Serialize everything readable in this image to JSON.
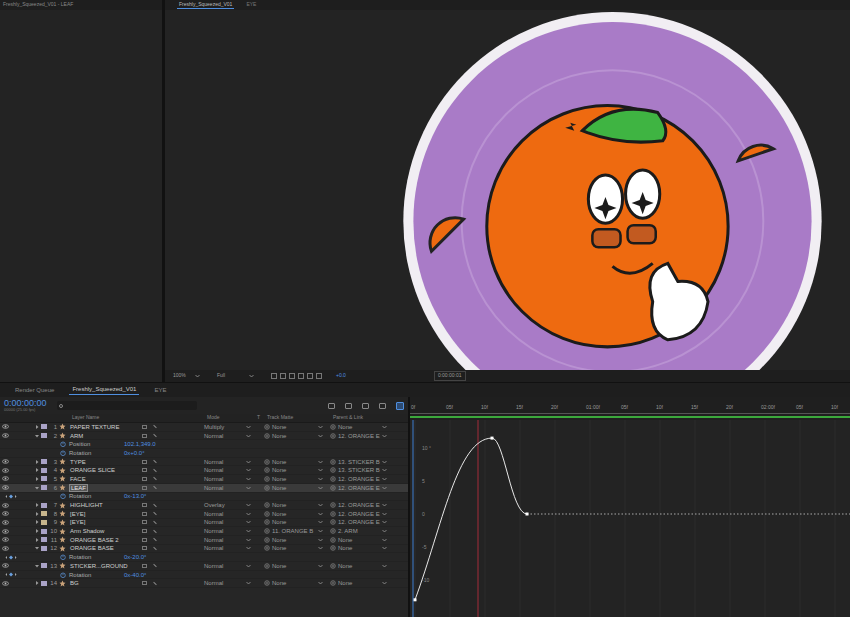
{
  "window": {
    "title": "Freshly_Squeezed_V01 - LEAF"
  },
  "viewer": {
    "tabs": [
      {
        "label": "Freshly_Squeezed_V01",
        "selected": true
      },
      {
        "label": "EYE",
        "selected": false
      }
    ],
    "footer": {
      "zoom": "100%",
      "resolution": "Full",
      "exposure": "+0.0",
      "time": "0:00:00:01"
    }
  },
  "timeline": {
    "tabs": [
      {
        "label": "Render Queue",
        "selected": false
      },
      {
        "label": "Freshly_Squeezed_V01",
        "selected": true
      },
      {
        "label": "EYE",
        "selected": false
      }
    ],
    "timecode": "0:00:00:00",
    "frame_info": "00000 (25.00 fps)",
    "search": {
      "placeholder": ""
    },
    "columns": {
      "name": "Layer Name",
      "mode": "Mode",
      "t": "T",
      "matte": "Track Matte",
      "parent": "Parent & Link"
    },
    "rows": [
      {
        "kind": "layer",
        "num": "1",
        "name": "PAPER TEXTURE",
        "color": "#a9a2c6",
        "mode": "Multiply",
        "matte": "None",
        "parent": "None",
        "selected": false,
        "expanded": false
      },
      {
        "kind": "layer",
        "num": "2",
        "name": "ARM",
        "color": "#a9a2c6",
        "mode": "Normal",
        "matte": "None",
        "parent": "12. ORANGE E",
        "selected": false,
        "expanded": true
      },
      {
        "kind": "property",
        "name": "Position",
        "value": "102.1,349.0",
        "keyframed": false
      },
      {
        "kind": "property",
        "name": "Rotation",
        "value": "0x+0.0°",
        "keyframed": false
      },
      {
        "kind": "layer",
        "num": "3",
        "name": "TYPE",
        "color": "#a9a2c6",
        "mode": "Normal",
        "matte": "None",
        "parent": "13. STICKER B",
        "selected": false,
        "expanded": false
      },
      {
        "kind": "layer",
        "num": "4",
        "name": "ORANGE SLICE",
        "color": "#a9a2c6",
        "mode": "Normal",
        "matte": "None",
        "parent": "13. STICKER B",
        "selected": false,
        "expanded": false
      },
      {
        "kind": "layer",
        "num": "5",
        "name": "FACE",
        "color": "#a9a2c6",
        "mode": "Normal",
        "matte": "None",
        "parent": "12. ORANGE E",
        "selected": false,
        "expanded": false
      },
      {
        "kind": "layer",
        "num": "6",
        "name": "LEAF",
        "color": "#a9a2c6",
        "mode": "Normal",
        "matte": "None",
        "parent": "12. ORANGE E",
        "selected": true,
        "expanded": true
      },
      {
        "kind": "property",
        "name": "Rotation",
        "value": "0x-13.0°",
        "keyframed": true
      },
      {
        "kind": "layer",
        "num": "7",
        "name": "HIGHLIGHT",
        "color": "#a9a2c6",
        "mode": "Overlay",
        "matte": "None",
        "parent": "12. ORANGE E",
        "selected": false,
        "expanded": false
      },
      {
        "kind": "layer",
        "num": "8",
        "name": "[EYE]",
        "color": "#c7b58c",
        "mode": "Normal",
        "matte": "None",
        "parent": "12. ORANGE E",
        "selected": false,
        "expanded": false
      },
      {
        "kind": "layer",
        "num": "9",
        "name": "[EYE]",
        "color": "#c7b58c",
        "mode": "Normal",
        "matte": "None",
        "parent": "12. ORANGE E",
        "selected": false,
        "expanded": false
      },
      {
        "kind": "layer",
        "num": "10",
        "name": "Arm Shadow",
        "color": "#a9a2c6",
        "mode": "Normal",
        "matte": "11. ORANGE B",
        "parent": "2. ARM",
        "selected": false,
        "expanded": false
      },
      {
        "kind": "layer",
        "num": "11",
        "name": "ORANGE BASE 2",
        "color": "#a9a2c6",
        "mode": "Normal",
        "matte": "None",
        "parent": "None",
        "selected": false,
        "expanded": false
      },
      {
        "kind": "layer",
        "num": "12",
        "name": "ORANGE BASE",
        "color": "#a9a2c6",
        "mode": "Normal",
        "matte": "None",
        "parent": "None",
        "selected": false,
        "expanded": true
      },
      {
        "kind": "property",
        "name": "Rotation",
        "value": "0x-20.0°",
        "keyframed": true
      },
      {
        "kind": "layer",
        "num": "13",
        "name": "STICKER...GROUND",
        "color": "#a9a2c6",
        "mode": "Normal",
        "matte": "None",
        "parent": "None",
        "selected": false,
        "expanded": true
      },
      {
        "kind": "property",
        "name": "Rotation",
        "value": "0x-40.0°",
        "keyframed": true
      },
      {
        "kind": "layer",
        "num": "14",
        "name": "BG",
        "color": "#a9a2c6",
        "mode": "Normal",
        "matte": "None",
        "parent": "None",
        "selected": false,
        "expanded": false
      }
    ],
    "ruler": [
      "0f",
      "05f",
      "10f",
      "15f",
      "20f",
      "01:00f",
      "05f",
      "10f",
      "15f",
      "20f",
      "02:00f",
      "05f",
      "10f"
    ],
    "graph": {
      "ticks": [
        {
          "label": "10 °",
          "value": 10
        },
        {
          "label": "5",
          "value": 5
        },
        {
          "label": "0",
          "value": 0
        },
        {
          "label": "-5",
          "value": -5
        },
        {
          "label": "-10",
          "value": -10
        }
      ],
      "keyframe_frames": [
        0,
        11,
        16
      ],
      "keyframe_values": [
        -13,
        11.5,
        0
      ],
      "marker_frame": 9
    }
  }
}
